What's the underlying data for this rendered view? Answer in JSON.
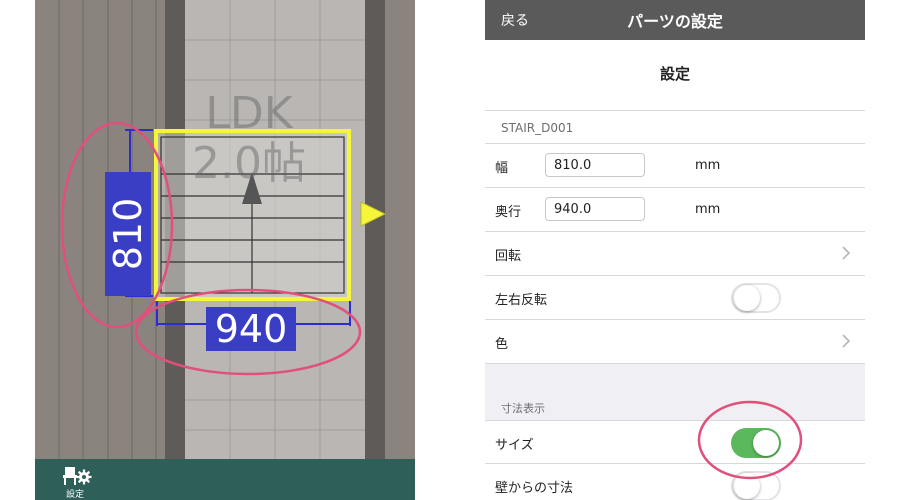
{
  "plan": {
    "room_name": "LDK",
    "room_size": "2.0帖",
    "depth_dimension": "810",
    "width_dimension": "940",
    "settings_button_label": "設定",
    "colors": {
      "highlight_circle": "#e0507a",
      "selection": "#f5f53a",
      "dimension_bg": "#3a3ec4"
    }
  },
  "settings": {
    "nav": {
      "back_label": "戻る",
      "title": "パーツの設定"
    },
    "sheet_title": "設定",
    "part_section_header": "STAIR_D001",
    "width": {
      "label": "幅",
      "value": "810.0",
      "unit": "mm"
    },
    "depth": {
      "label": "奥行",
      "value": "940.0",
      "unit": "mm"
    },
    "rotate": {
      "label": "回転"
    },
    "mirror": {
      "label": "左右反転",
      "enabled": false
    },
    "color": {
      "label": "色"
    },
    "dimension_section_header": "寸法表示",
    "size_display": {
      "label": "サイズ",
      "enabled": true
    },
    "wall_distance": {
      "label": "壁からの寸法",
      "enabled": false
    },
    "colors": {
      "toggle_on": "#5cb85c",
      "navbar": "#5a5a5a"
    }
  }
}
